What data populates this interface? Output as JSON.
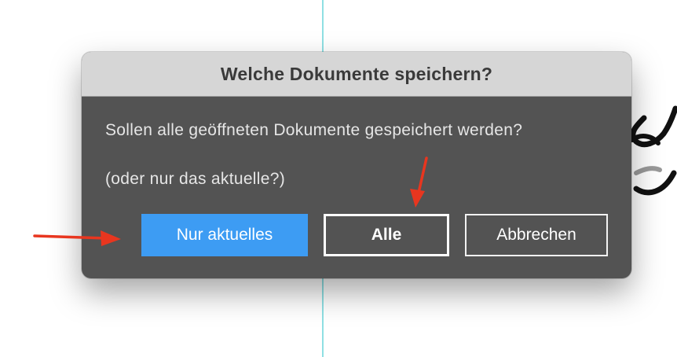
{
  "dialog": {
    "title": "Welche Dokumente speichern?",
    "message": "Sollen alle geöffneten Dokumente gespeichert werden?",
    "submessage": "(oder nur das aktuelle?)",
    "buttons": {
      "current_only": "Nur aktuelles",
      "all": "Alle",
      "cancel": "Abbrechen"
    }
  },
  "colors": {
    "dialog_background": "#535353",
    "titlebar": "#d6d6d6",
    "primary_button": "#3d9cf3",
    "annotation_arrow": "#e8361f",
    "guide_line": "#8fe0e3"
  },
  "icons": [
    "red-arrow-right-icon",
    "red-arrow-down-icon"
  ]
}
